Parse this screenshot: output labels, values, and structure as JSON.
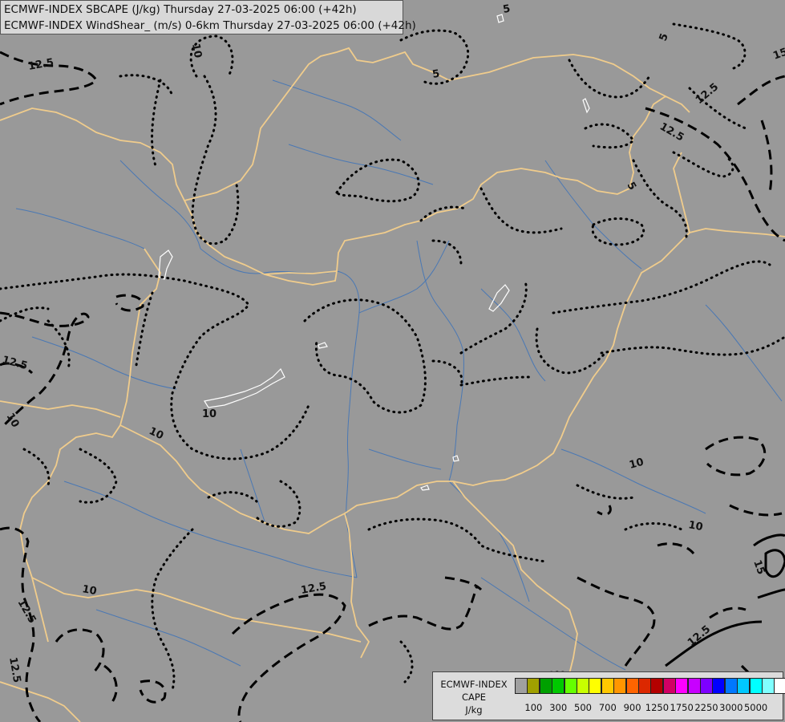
{
  "header": {
    "line1": "ECMWF-INDEX SBCAPE (J/kg) Thursday 27-03-2025 06:00 (+42h)",
    "line2": "ECMWF-INDEX WindShear_ (m/s) 0-6km Thursday 27-03-2025 06:00 (+42h)"
  },
  "legend": {
    "title1": "ECMWF-INDEX",
    "title2": "CAPE",
    "title3": "J/kg",
    "swatch_colors": [
      "#a0a0a0",
      "#a0a000",
      "#00a000",
      "#00c800",
      "#64ff00",
      "#c8ff00",
      "#ffff00",
      "#ffc800",
      "#ff9600",
      "#ff6400",
      "#dc2800",
      "#b40000",
      "#d20064",
      "#ff00ff",
      "#c800ff",
      "#7d00ff",
      "#0000ff",
      "#0078ff",
      "#00c8ff",
      "#00ffff",
      "#80ffff",
      "#ffffff"
    ],
    "ticks": [
      "100",
      "300",
      "500",
      "700",
      "900",
      "1250",
      "1750",
      "2250",
      "3000",
      "5000"
    ]
  },
  "map": {
    "colors": {
      "background": "#999999",
      "border": "#f0cc8c",
      "river": "#4a78b4",
      "lake": "#ffffff",
      "contour": "#000000"
    },
    "contour_labels": [
      "5",
      "5",
      "5",
      "5",
      "10",
      "12.5",
      "12.5",
      "12.5",
      "12.5",
      "12.5",
      "10",
      "10",
      "10",
      "10",
      "10",
      "10",
      "12.5",
      "12.5",
      "12.5",
      "15",
      "15"
    ]
  }
}
